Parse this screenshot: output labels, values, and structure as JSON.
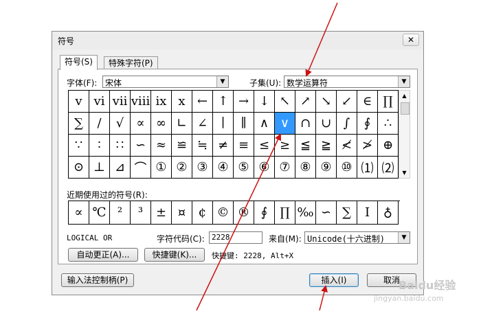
{
  "dialog": {
    "title": "符号",
    "close_glyph": "✕",
    "tabs": [
      {
        "label": "符号(S)",
        "active": true
      },
      {
        "label": "特殊字符(P)",
        "active": false
      }
    ],
    "font_label": "字体(F):",
    "font_value": "宋体",
    "subset_label": "子集(U):",
    "subset_value": "数学运算符",
    "symbol_grid": [
      [
        "v",
        "vi",
        "vii",
        "viii",
        "ix",
        "x",
        "←",
        "↑",
        "→",
        "↓",
        "↖",
        "↗",
        "↘",
        "↙",
        "∈",
        "∏"
      ],
      [
        "∑",
        "∕",
        "√",
        "∝",
        "∞",
        "∟",
        "∠",
        "∣",
        "∥",
        "∧",
        "∨",
        "∩",
        "∪",
        "∫",
        "∮",
        "∴"
      ],
      [
        "∵",
        "∶",
        "∷",
        "∽",
        "≈",
        "≌",
        "≒",
        "≠",
        "≡",
        "≤",
        "≥",
        "≦",
        "≧",
        "≮",
        "≯",
        "⊕"
      ],
      [
        "⊙",
        "⊥",
        "⊿",
        "⌒",
        "①",
        "②",
        "③",
        "④",
        "⑤",
        "⑥",
        "⑦",
        "⑧",
        "⑨",
        "⑩",
        "⑴",
        "⑵"
      ]
    ],
    "selected_symbol": "∨",
    "recent_label": "近期使用过的符号(R):",
    "recent_symbols": [
      "∝",
      "℃",
      "²",
      "³",
      "±",
      "¤",
      "¢",
      "©",
      "®",
      "∮",
      "∏",
      "‰",
      "∽",
      "∑",
      "Ⅰ",
      "♁"
    ],
    "char_name": "LOGICAL OR",
    "char_code_label": "字符代码(C):",
    "char_code_value": "2228",
    "from_label": "来自(M):",
    "from_value": "Unicode(十六进制)",
    "autocorrect_button": "自动更正(A)...",
    "shortcut_button": "快捷键(K)...",
    "shortcut_info": "快捷键: 2228, Alt+X",
    "ime_button": "输入法控制柄(P)",
    "insert_button": "插入(I)",
    "cancel_button": "取消"
  },
  "annotation_color": "#cc1111",
  "watermark": {
    "main": "Baidu经验",
    "sub": "jingyan.baidu.com"
  }
}
